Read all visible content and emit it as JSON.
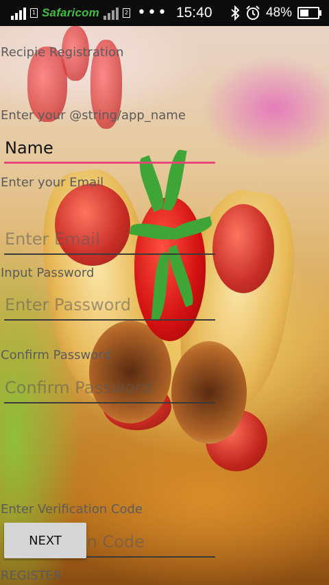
{
  "status_bar": {
    "carrier": "Safaricom",
    "sim1_label": "1",
    "sim2_label": "2",
    "overflow_dots": "•••",
    "time": "15:40",
    "battery_percent": "48%",
    "battery_level": 0.48,
    "icons": [
      "signal-icon",
      "bluetooth-icon",
      "alarm-icon",
      "battery-icon"
    ]
  },
  "form": {
    "title": "Recipie Registration",
    "name_label": "Enter your @string/app_name",
    "name_value": "Name",
    "email_label": "Enter your Email",
    "email_placeholder": "Enter Email",
    "password_label": "Input Password",
    "password_placeholder": "Enter Password",
    "confirm_label": "Confirm Password",
    "confirm_placeholder": "Confirm Password",
    "code_label": "Enter Verification Code",
    "code_placeholder": "Verification Code",
    "next_button": "NEXT",
    "register_label": "REGISTER"
  },
  "colors": {
    "accent_underline": "#e8457a",
    "status_bar": "#0c0c0c",
    "carrier": "#3fbf3f"
  }
}
